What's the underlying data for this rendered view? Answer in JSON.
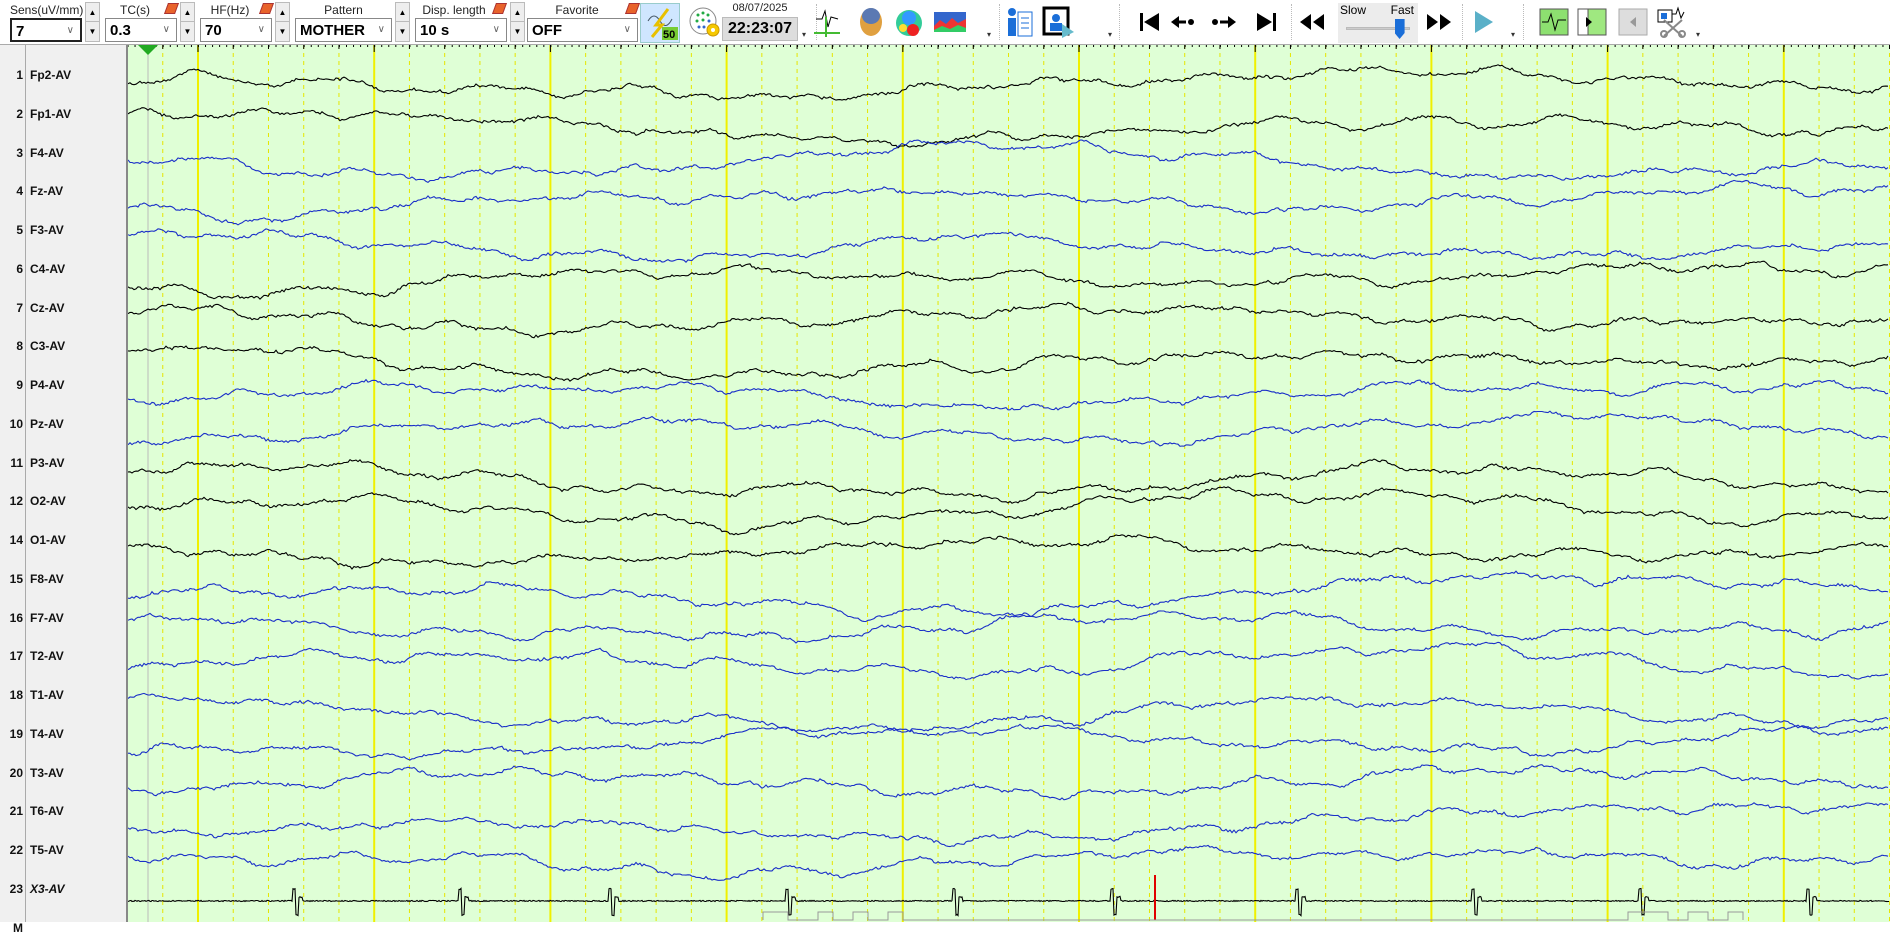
{
  "toolbar": {
    "sens": {
      "label": "Sens(uV/mm)",
      "value": "7"
    },
    "tc": {
      "label": "TC(s)",
      "value": "0.3"
    },
    "hf": {
      "label": "HF(Hz)",
      "value": "70"
    },
    "pattern": {
      "label": "Pattern",
      "value": "MOTHER"
    },
    "disp": {
      "label": "Disp. length",
      "value": "10 s"
    },
    "favorite": {
      "label": "Favorite",
      "value": "OFF"
    },
    "notch_badge": "50",
    "date": "08/07/2025",
    "time": "22:23:07",
    "speed": {
      "slow": "Slow",
      "fast": "Fast",
      "value": 0.9
    },
    "spin_up": "▲",
    "spin_down": "▼",
    "chevron": "∨",
    "dropdown": "▾"
  },
  "channels": [
    {
      "num": "1",
      "name": "Fp2-AV",
      "color": "#000000"
    },
    {
      "num": "2",
      "name": "Fp1-AV",
      "color": "#000000"
    },
    {
      "num": "3",
      "name": "F4-AV",
      "color": "#1a2fc8"
    },
    {
      "num": "4",
      "name": "Fz-AV",
      "color": "#1a2fc8"
    },
    {
      "num": "5",
      "name": "F3-AV",
      "color": "#1a2fc8"
    },
    {
      "num": "6",
      "name": "C4-AV",
      "color": "#000000"
    },
    {
      "num": "7",
      "name": "Cz-AV",
      "color": "#000000"
    },
    {
      "num": "8",
      "name": "C3-AV",
      "color": "#000000"
    },
    {
      "num": "9",
      "name": "P4-AV",
      "color": "#1a2fc8"
    },
    {
      "num": "10",
      "name": "Pz-AV",
      "color": "#1a2fc8"
    },
    {
      "num": "11",
      "name": "P3-AV",
      "color": "#000000"
    },
    {
      "num": "12",
      "name": "O2-AV",
      "color": "#000000"
    },
    {
      "num": "14",
      "name": "O1-AV",
      "color": "#000000"
    },
    {
      "num": "15",
      "name": "F8-AV",
      "color": "#1a2fc8"
    },
    {
      "num": "16",
      "name": "F7-AV",
      "color": "#1a2fc8"
    },
    {
      "num": "17",
      "name": "T2-AV",
      "color": "#1a2fc8"
    },
    {
      "num": "18",
      "name": "T1-AV",
      "color": "#1a2fc8"
    },
    {
      "num": "19",
      "name": "T4-AV",
      "color": "#1a2fc8"
    },
    {
      "num": "20",
      "name": "T3-AV",
      "color": "#1a2fc8"
    },
    {
      "num": "21",
      "name": "T6-AV",
      "color": "#1a2fc8"
    },
    {
      "num": "22",
      "name": "T5-AV",
      "color": "#1a2fc8"
    },
    {
      "num": "23",
      "name": "X3-AV",
      "color": "#000000",
      "ecg": true
    }
  ],
  "marker_row": "M",
  "display_seconds": 10,
  "colors": {
    "background": "#dfffd6",
    "grid_second": "#f0f000",
    "grid_sub": "#e6e600",
    "event": "#e00000"
  }
}
